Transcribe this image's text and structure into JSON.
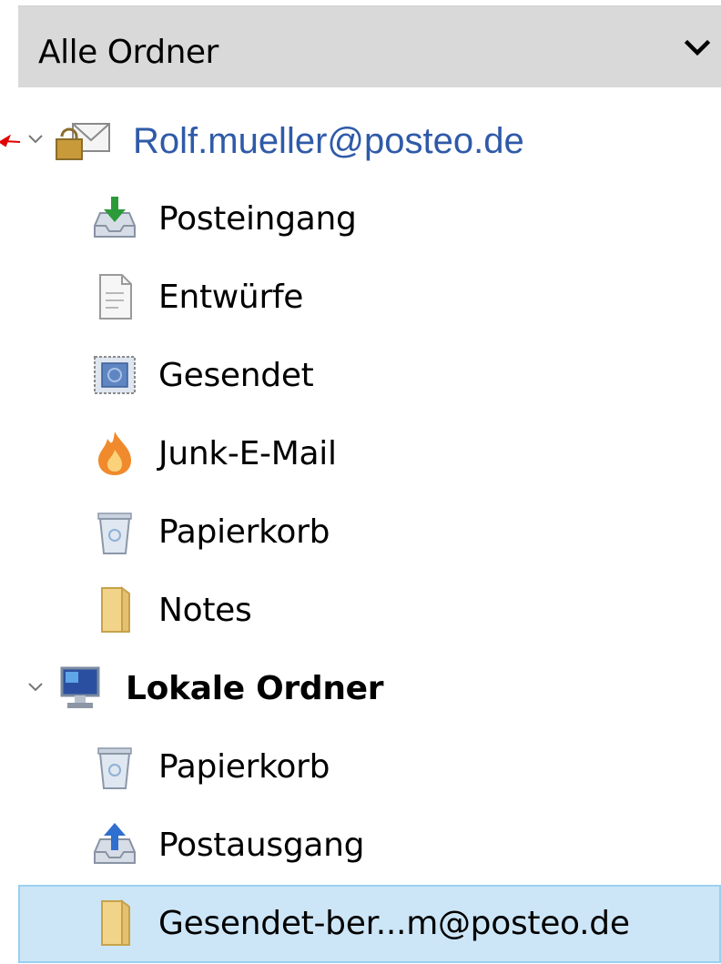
{
  "header": {
    "title": "Alle Ordner",
    "chevron_icon": "chevron-down-icon"
  },
  "account": {
    "email": "Rolf.mueller@posteo.de",
    "icon": "locked-mail-account-icon",
    "annotation_arrow_color": "#e00000"
  },
  "folders": [
    {
      "label": "Posteingang",
      "icon": "inbox-icon"
    },
    {
      "label": "Entwürfe",
      "icon": "drafts-icon"
    },
    {
      "label": "Gesendet",
      "icon": "sent-icon"
    },
    {
      "label": "Junk-E-Mail",
      "icon": "junk-icon"
    },
    {
      "label": "Papierkorb",
      "icon": "trash-icon"
    },
    {
      "label": "Notes",
      "icon": "folder-icon"
    }
  ],
  "local": {
    "title": "Lokale Ordner",
    "icon": "computer-icon",
    "folders": [
      {
        "label": "Papierkorb",
        "icon": "trash-icon"
      },
      {
        "label": "Postausgang",
        "icon": "outbox-icon"
      },
      {
        "label": "Gesendet-ber...m@posteo.de",
        "icon": "folder-icon",
        "selected": true
      }
    ]
  },
  "colors": {
    "header_bg": "#d9d9d9",
    "selection_bg": "#cde6f7",
    "selection_border": "#99d1ef",
    "account_text": "#2f5aa8"
  }
}
